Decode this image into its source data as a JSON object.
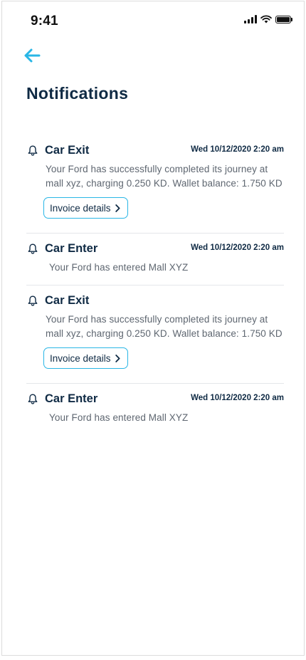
{
  "status_bar": {
    "time": "9:41",
    "icons": [
      "cellular-signal-icon",
      "wifi-icon",
      "battery-icon"
    ]
  },
  "header": {
    "back_icon": "arrow-left-icon",
    "title": "Notifications"
  },
  "colors": {
    "accent": "#29b6e6",
    "title_text": "#0f2a44",
    "body_text": "#5e6670",
    "divider": "#e4e6ea"
  },
  "notifications": [
    {
      "icon": "bell-icon",
      "title": "Car Exit",
      "time": "Wed 10/12/2020 2:20 am",
      "message": "Your Ford has successfully completed its journey at mall xyz, charging 0.250 KD. Wallet balance: 1.750 KD",
      "action_label": "Invoice details",
      "action_icon": "chevron-right-icon"
    },
    {
      "icon": "bell-icon",
      "title": "Car Enter",
      "time": "Wed 10/12/2020 2:20 am",
      "message": "Your Ford has entered Mall XYZ"
    },
    {
      "icon": "bell-icon",
      "title": "Car Exit",
      "time": "",
      "message": "Your Ford has successfully completed its journey at mall xyz, charging 0.250 KD. Wallet balance: 1.750 KD",
      "action_label": "Invoice details",
      "action_icon": "chevron-right-icon"
    },
    {
      "icon": "bell-icon",
      "title": "Car Enter",
      "time": "Wed 10/12/2020 2:20 am",
      "message": "Your Ford has entered Mall XYZ"
    }
  ]
}
